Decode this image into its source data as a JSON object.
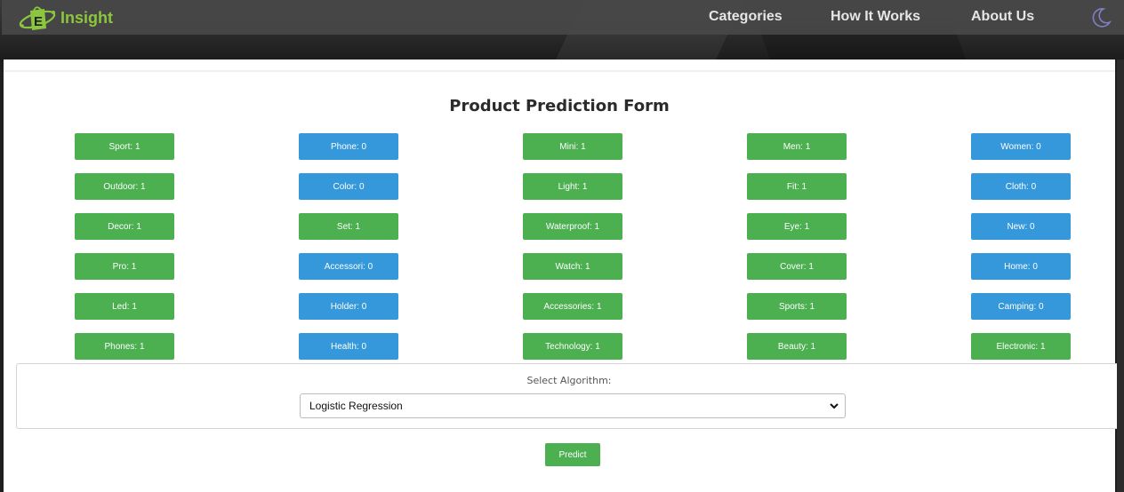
{
  "header": {
    "logo_letter": "E",
    "logo_text": "Insight",
    "nav": [
      "Categories",
      "How It Works",
      "About Us"
    ],
    "theme_icon": "moon-icon"
  },
  "form": {
    "title": "Product Prediction Form",
    "features": [
      {
        "label": "Sport: 1",
        "color": "green"
      },
      {
        "label": "Phone: 0",
        "color": "blue"
      },
      {
        "label": "Mini: 1",
        "color": "green"
      },
      {
        "label": "Men: 1",
        "color": "green"
      },
      {
        "label": "Women: 0",
        "color": "blue"
      },
      {
        "label": "Outdoor: 1",
        "color": "green"
      },
      {
        "label": "Color: 0",
        "color": "blue"
      },
      {
        "label": "Light: 1",
        "color": "green"
      },
      {
        "label": "Fit: 1",
        "color": "green"
      },
      {
        "label": "Cloth: 0",
        "color": "blue"
      },
      {
        "label": "Decor: 1",
        "color": "green"
      },
      {
        "label": "Set: 1",
        "color": "green"
      },
      {
        "label": "Waterproof: 1",
        "color": "green"
      },
      {
        "label": "Eye: 1",
        "color": "green"
      },
      {
        "label": "New: 0",
        "color": "blue"
      },
      {
        "label": "Pro: 1",
        "color": "green"
      },
      {
        "label": "Accessori: 0",
        "color": "blue"
      },
      {
        "label": "Watch: 1",
        "color": "green"
      },
      {
        "label": "Cover: 1",
        "color": "green"
      },
      {
        "label": "Home: 0",
        "color": "blue"
      },
      {
        "label": "Led: 1",
        "color": "green"
      },
      {
        "label": "Holder: 0",
        "color": "blue"
      },
      {
        "label": "Accessories: 1",
        "color": "green"
      },
      {
        "label": "Sports: 1",
        "color": "green"
      },
      {
        "label": "Camping: 0",
        "color": "blue"
      },
      {
        "label": "Phones: 1",
        "color": "green"
      },
      {
        "label": "Health: 0",
        "color": "blue"
      },
      {
        "label": "Technology: 1",
        "color": "green"
      },
      {
        "label": "Beauty: 1",
        "color": "green"
      },
      {
        "label": "Electronic: 1",
        "color": "green"
      }
    ],
    "algorithm_label": "Select Algorithm:",
    "algorithm_selected": "Logistic Regression",
    "predict_label": "Predict"
  },
  "colors": {
    "green": "#4caf50",
    "blue": "#3598db",
    "logo_green": "#8cc63f"
  }
}
